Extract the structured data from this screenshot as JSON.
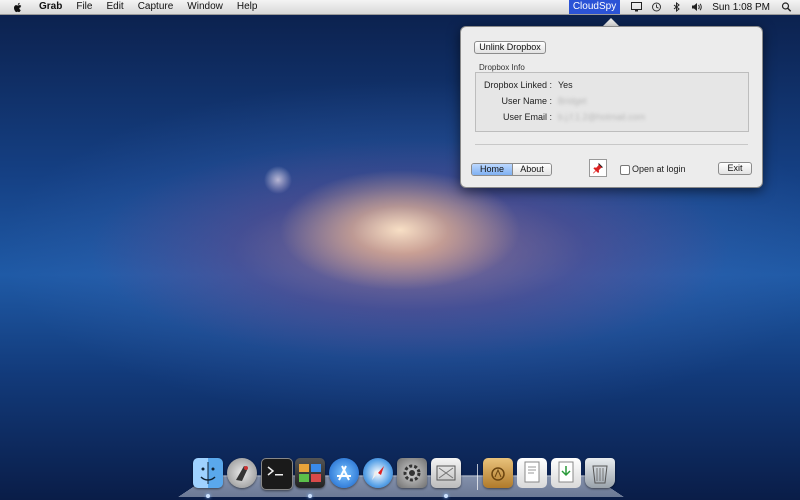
{
  "menubar": {
    "app_name": "Grab",
    "menus": [
      "File",
      "Edit",
      "Capture",
      "Window",
      "Help"
    ],
    "status_item": "CloudSpy",
    "clock": "Sun 1:08 PM",
    "status_icons": [
      "display-icon",
      "time-machine-icon",
      "bluetooth-icon",
      "volume-icon",
      "spotlight-icon"
    ]
  },
  "popover": {
    "unlink_button": "Unlink Dropbox",
    "group_title": "Dropbox Info",
    "rows": [
      {
        "label": "Dropbox Linked :",
        "value": "Yes"
      },
      {
        "label": "User Name :",
        "value": "Bridget"
      },
      {
        "label": "User Email :",
        "value": "b.j.f.1.2@hotmail.com"
      }
    ],
    "tabs": {
      "home": "Home",
      "about": "About"
    },
    "open_at_login": "Open at login",
    "open_at_login_checked": false,
    "exit_button": "Exit"
  },
  "dock": {
    "apps": [
      "finder-icon",
      "launchpad-icon",
      "terminal-icon",
      "photo-browser-icon",
      "app-store-icon",
      "safari-icon",
      "system-preferences-icon",
      "grab-icon"
    ],
    "others": [
      "applications-folder-icon",
      "documents-stack-icon",
      "downloads-stack-icon",
      "trash-icon"
    ]
  },
  "colors": {
    "status_item_bg": "#2b53d6",
    "selected_tab": "#7fb0f2"
  }
}
